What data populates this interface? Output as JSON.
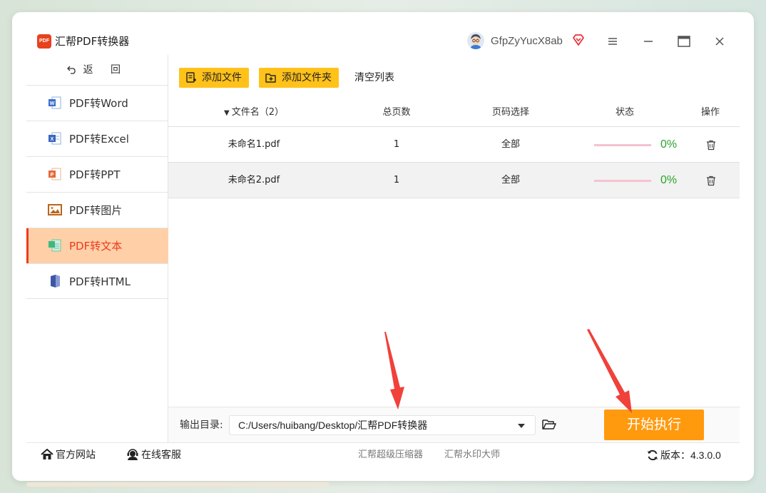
{
  "app": {
    "title": "汇帮PDF转换器",
    "logo_text": "PDF",
    "username": "GfpZyYucX8ab"
  },
  "sidebar": {
    "back_label": "返 回",
    "items": [
      {
        "label": "PDF转Word",
        "icon": "word-icon",
        "active": false
      },
      {
        "label": "PDF转Excel",
        "icon": "excel-icon",
        "active": false
      },
      {
        "label": "PDF转PPT",
        "icon": "ppt-icon",
        "active": false
      },
      {
        "label": "PDF转图片",
        "icon": "image-icon",
        "active": false
      },
      {
        "label": "PDF转文本",
        "icon": "text-icon",
        "active": true
      },
      {
        "label": "PDF转HTML",
        "icon": "html-icon",
        "active": false
      }
    ]
  },
  "toolbar": {
    "add_file": "添加文件",
    "add_folder": "添加文件夹",
    "clear_list": "清空列表"
  },
  "table": {
    "headers": {
      "name": "文件名（2）",
      "pages": "总页数",
      "range": "页码选择",
      "status": "状态",
      "op": "操作"
    },
    "rows": [
      {
        "name": "未命名1.pdf",
        "pages": "1",
        "range": "全部",
        "progress": "0%"
      },
      {
        "name": "未命名2.pdf",
        "pages": "1",
        "range": "全部",
        "progress": "0%"
      }
    ]
  },
  "output": {
    "label": "输出目录:",
    "path": "C:/Users/huibang/Desktop/汇帮PDF转换器"
  },
  "start_button": "开始执行",
  "footer": {
    "official_site": "官方网站",
    "online_service": "在线客服",
    "compressor": "汇帮超级压缩器",
    "watermark": "汇帮水印大师",
    "version_label": "版本：",
    "version": "4.3.0.0"
  },
  "colors": {
    "accent": "#ffc21a",
    "active_bg": "#ffd0a8",
    "active_text": "#ef3a1c",
    "start_button": "#ff9a0e",
    "progress_text": "#2aa42a",
    "annotation_arrow": "#f0413a"
  }
}
